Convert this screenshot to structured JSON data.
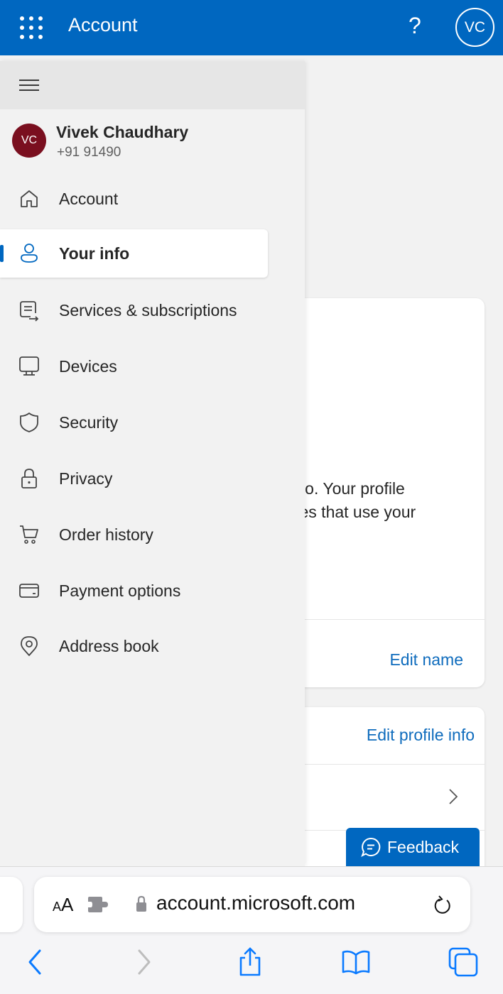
{
  "header": {
    "app_title": "Account",
    "help_label": "?",
    "user_initials": "VC"
  },
  "drawer": {
    "profile": {
      "initials": "VC",
      "name": "Vivek Chaudhary",
      "phone": "+91 91490"
    },
    "items": [
      {
        "label": "Account",
        "icon": "home-icon",
        "active": false
      },
      {
        "label": "Your info",
        "icon": "person-icon",
        "active": true
      },
      {
        "label": "Services & subscriptions",
        "icon": "subscriptions-icon",
        "active": false
      },
      {
        "label": "Devices",
        "icon": "monitor-icon",
        "active": false
      },
      {
        "label": "Security",
        "icon": "shield-icon",
        "active": false
      },
      {
        "label": "Privacy",
        "icon": "lock-icon",
        "active": false
      },
      {
        "label": "Order history",
        "icon": "cart-icon",
        "active": false
      },
      {
        "label": "Payment options",
        "icon": "credit-card-icon",
        "active": false
      },
      {
        "label": "Address book",
        "icon": "location-pin-icon",
        "active": false
      }
    ]
  },
  "main": {
    "name_card": {
      "description_line1": "oto. Your profile",
      "description_line2": "ces that use your",
      "edit_link": "Edit name"
    },
    "profile_card": {
      "edit_link": "Edit profile info"
    },
    "feedback_label": "Feedback"
  },
  "browser": {
    "text_size_label_small": "A",
    "text_size_label_large": "A",
    "url": "account.microsoft.com"
  },
  "colors": {
    "brand_blue": "#0067c0",
    "link_blue": "#0f6cbd",
    "avatar_maroon": "#7a0f1f"
  }
}
